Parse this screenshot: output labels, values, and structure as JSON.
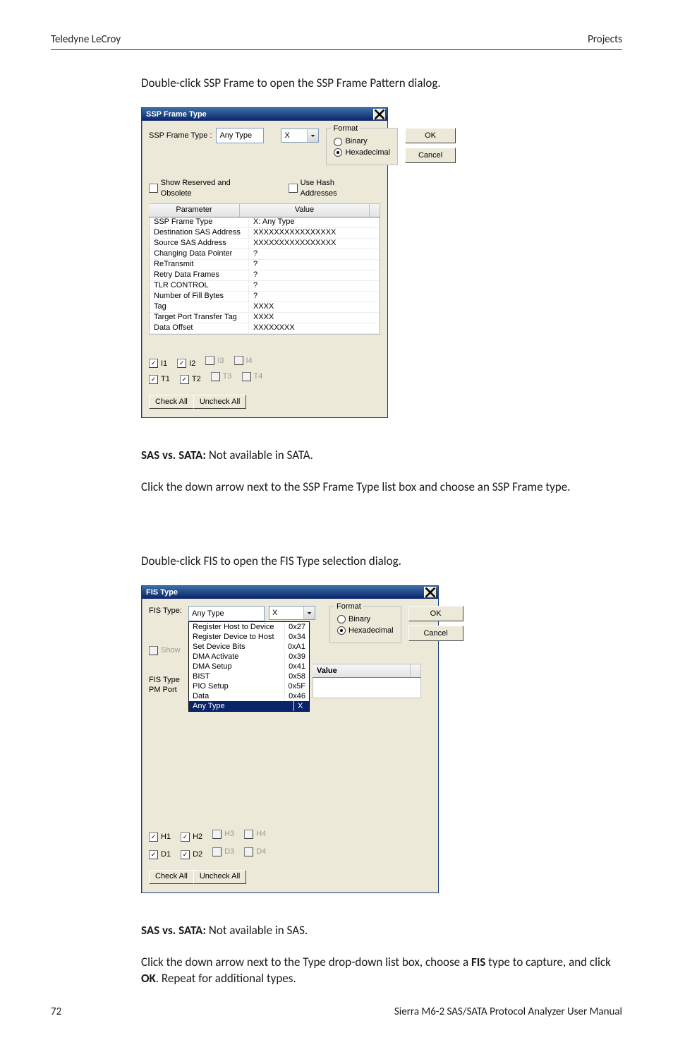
{
  "header": {
    "left": "Teledyne LeCroy",
    "right": "Projects"
  },
  "footer": {
    "left": "72",
    "right": "Sierra M6-2 SAS/SATA Protocol Analyzer User Manual"
  },
  "intro1": "Double-click SSP Frame to open the SSP Frame Pattern dialog.",
  "dlg1": {
    "title": "SSP Frame Type",
    "frame_type_label": "SSP Frame Type :",
    "frame_type_value": "Any Type",
    "x_value": "X",
    "format_legend": "Format",
    "radio_binary": "Binary",
    "radio_hex": "Hexadecimal",
    "ok": "OK",
    "cancel": "Cancel",
    "show_reserved": "Show Reserved and Obsolete",
    "use_hash": "Use Hash Addresses",
    "col_param": "Parameter",
    "col_value": "Value",
    "rows": [
      {
        "p": "SSP Frame Type",
        "v": "X: Any Type"
      },
      {
        "p": "Destination SAS Address",
        "v": "XXXXXXXXXXXXXXXX"
      },
      {
        "p": "Source SAS Address",
        "v": "XXXXXXXXXXXXXXXX"
      },
      {
        "p": "Changing Data Pointer",
        "v": "?"
      },
      {
        "p": "ReTransmit",
        "v": "?"
      },
      {
        "p": "Retry Data Frames",
        "v": "?"
      },
      {
        "p": "TLR CONTROL",
        "v": "?"
      },
      {
        "p": "Number of Fill Bytes",
        "v": "?"
      },
      {
        "p": "Tag",
        "v": "XXXX"
      },
      {
        "p": "Target Port Transfer Tag",
        "v": "XXXX"
      },
      {
        "p": "Data Offset",
        "v": "XXXXXXXX"
      }
    ],
    "chk_i": [
      "I1",
      "I2",
      "I3",
      "I4"
    ],
    "chk_t": [
      "T1",
      "T2",
      "T3",
      "T4"
    ],
    "check_all": "Check All",
    "uncheck_all": "Uncheck All"
  },
  "sas_sata_label": "SAS vs. SATA:",
  "sas_sata_1": " Not available in SATA.",
  "after_dlg1": "Click the down arrow next to the SSP Frame Type list box and choose an SSP Frame type.",
  "intro2": "Double-click FIS to open the FIS Type selection dialog.",
  "dlg2": {
    "title": "FIS Type",
    "fis_type_label": "FIS Type:",
    "fis_type_value": "Any Type",
    "x_value": "X",
    "format_legend": "Format",
    "radio_binary": "Binary",
    "radio_hex": "Hexadecimal",
    "ok": "OK",
    "cancel": "Cancel",
    "show_label": "Show",
    "left_labels": {
      "fis_type": "FIS Type",
      "pm_port": "PM Port"
    },
    "value_header": "Value",
    "options": [
      {
        "name": "Register Host to Device",
        "code": "0x27"
      },
      {
        "name": "Register Device to Host",
        "code": "0x34"
      },
      {
        "name": "Set Device Bits",
        "code": "0xA1"
      },
      {
        "name": "DMA Activate",
        "code": "0x39"
      },
      {
        "name": "DMA Setup",
        "code": "0x41"
      },
      {
        "name": "BIST",
        "code": "0x58"
      },
      {
        "name": "PIO Setup",
        "code": "0x5F"
      },
      {
        "name": "Data",
        "code": "0x46"
      },
      {
        "name": "Any Type",
        "code": "X"
      }
    ],
    "chk_h": [
      "H1",
      "H2",
      "H3",
      "H4"
    ],
    "chk_d": [
      "D1",
      "D2",
      "D3",
      "D4"
    ],
    "check_all": "Check All",
    "uncheck_all": "Uncheck All"
  },
  "sas_sata_2": " Not available in SAS.",
  "after_dlg2_a": "Click the down arrow next to the Type drop-down list box, choose a ",
  "after_dlg2_fis": "FIS",
  "after_dlg2_b": " type to capture, and click ",
  "after_dlg2_ok": "OK",
  "after_dlg2_c": ". Repeat for additional types."
}
